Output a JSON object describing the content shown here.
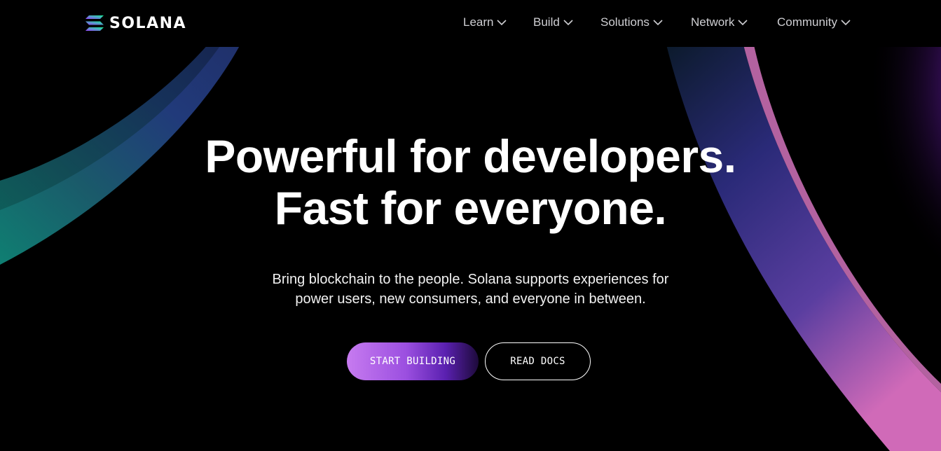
{
  "brand": {
    "name": "SOLANA"
  },
  "nav": {
    "items": [
      {
        "label": "Learn"
      },
      {
        "label": "Build"
      },
      {
        "label": "Solutions"
      },
      {
        "label": "Network"
      },
      {
        "label": "Community"
      }
    ]
  },
  "hero": {
    "title_line1": "Powerful for developers.",
    "title_line2": "Fast for everyone.",
    "subtitle_line1": "Bring blockchain to the people. Solana supports experiences for",
    "subtitle_line2": "power users, new consumers, and everyone in between.",
    "primary_button": "START BUILDING",
    "secondary_button": "READ DOCS"
  },
  "colors": {
    "background": "#000000",
    "accent_purple": "#9945FF",
    "accent_green": "#14F195",
    "nav_text": "#cfcfd3"
  }
}
